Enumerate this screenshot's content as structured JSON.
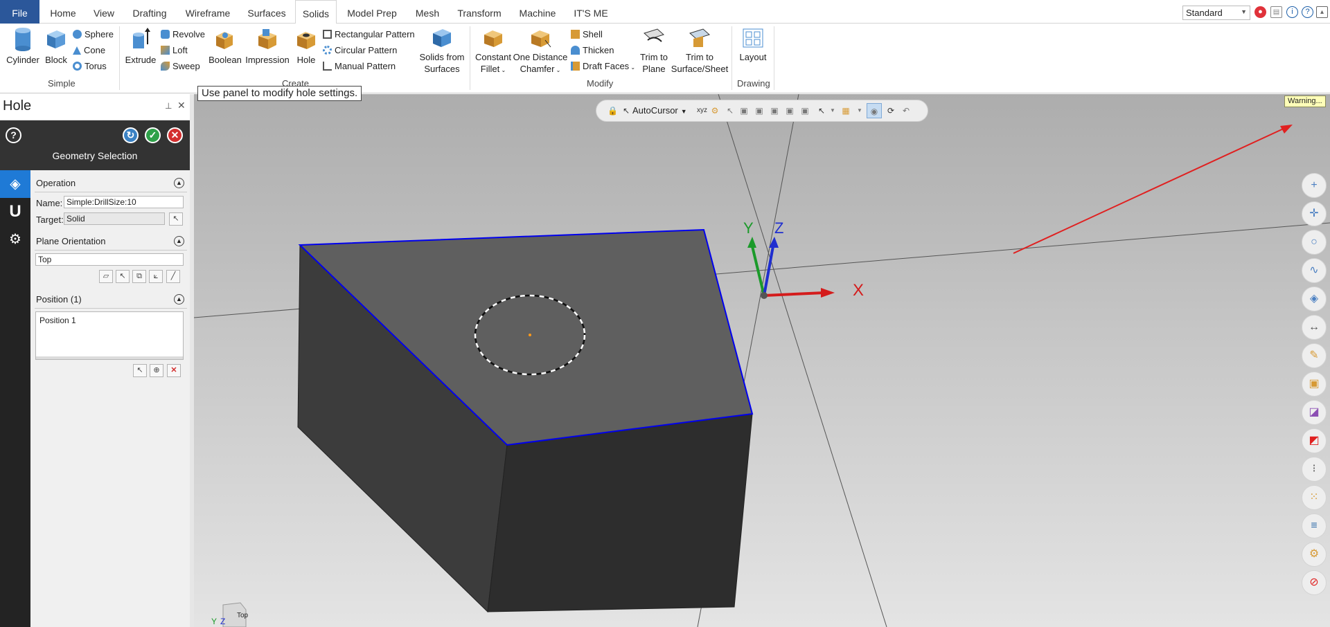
{
  "tabs": [
    {
      "label": "File",
      "type": "file"
    },
    {
      "label": "Home"
    },
    {
      "label": "View"
    },
    {
      "label": "Drafting"
    },
    {
      "label": "Wireframe"
    },
    {
      "label": "Surfaces"
    },
    {
      "label": "Solids",
      "active": true
    },
    {
      "label": "Model Prep"
    },
    {
      "label": "Mesh"
    },
    {
      "label": "Transform"
    },
    {
      "label": "Machine"
    },
    {
      "label": "IT'S ME"
    }
  ],
  "view_mode": "Standard",
  "ribbon": {
    "simple": {
      "group_label": "Simple",
      "cylinder": "Cylinder",
      "block": "Block",
      "sphere": "Sphere",
      "cone": "Cone",
      "torus": "Torus"
    },
    "create": {
      "group_label": "Create",
      "extrude": "Extrude",
      "revolve": "Revolve",
      "loft": "Loft",
      "sweep": "Sweep",
      "boolean": "Boolean",
      "impression": "Impression",
      "hole": "Hole",
      "rect_pattern": "Rectangular Pattern",
      "circ_pattern": "Circular Pattern",
      "manual_pattern": "Manual Pattern",
      "solids_from_1": "Solids from",
      "solids_from_2": "Surfaces"
    },
    "modify": {
      "group_label": "Modify",
      "fillet_1": "Constant",
      "fillet_2": "Fillet",
      "chamfer_1": "One Distance",
      "chamfer_2": "Chamfer",
      "shell": "Shell",
      "thicken": "Thicken",
      "draft": "Draft Faces",
      "trim_plane_1": "Trim to",
      "trim_plane_2": "Plane",
      "trim_surface_1": "Trim to",
      "trim_surface_2": "Surface/Sheet"
    },
    "drawing": {
      "group_label": "Drawing",
      "layout": "Layout"
    }
  },
  "tooltip": "Use panel to modify hole settings.",
  "panel": {
    "title": "Hole",
    "subtitle": "Geometry Selection",
    "operation": {
      "header": "Operation",
      "name_label": "Name:",
      "name_value": "Simple:DrillSize:10",
      "target_label": "Target:",
      "target_value": "Solid"
    },
    "plane": {
      "header": "Plane Orientation",
      "value": "Top"
    },
    "position": {
      "header": "Position (1)",
      "items": [
        "Position 1"
      ]
    }
  },
  "viewport": {
    "toolbar_mode": "AutoCursor",
    "warning": "Warning...",
    "gnomon_x": "X",
    "gnomon_y": "Y",
    "gnomon_z": "Z",
    "viewcube": "Top",
    "mini_y": "Y",
    "mini_z": "Z"
  },
  "colors": {
    "file_tab": "#2b579a",
    "selected_edge": "#0000ee",
    "axis_x": "#d41c1c",
    "axis_y": "#1b9a2a",
    "axis_z": "#1f2ecf",
    "panel_dark": "#333333",
    "accent_blue": "#1f7ad6"
  }
}
